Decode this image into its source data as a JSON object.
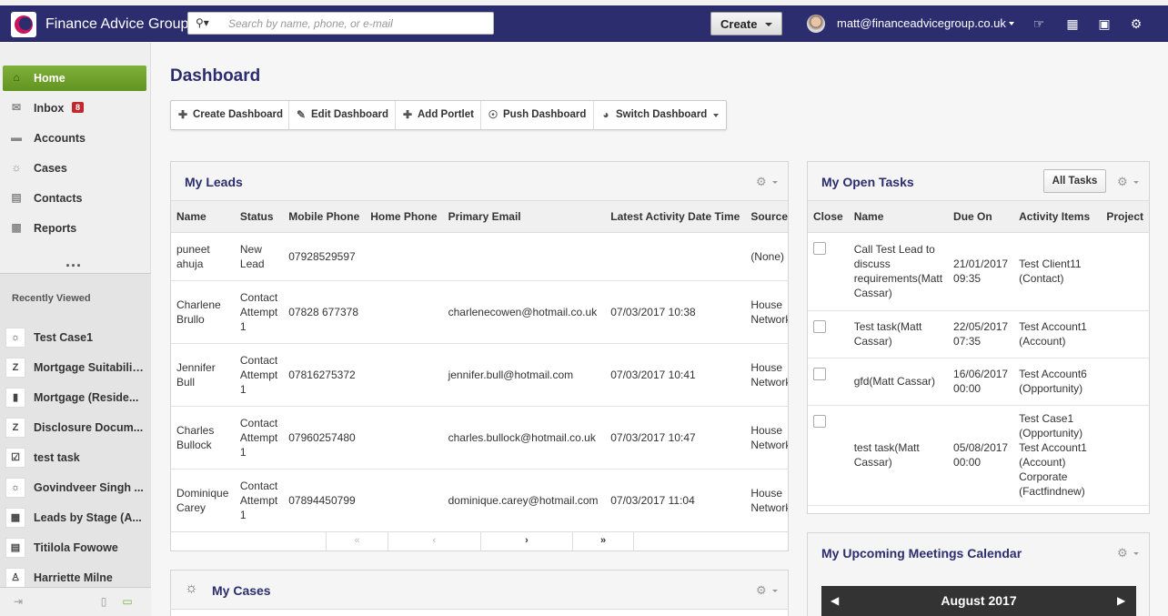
{
  "header": {
    "brand": "Finance Advice Group",
    "search_placeholder": "Search by name, phone, or e-mail",
    "create_label": "Create",
    "user_email": "matt@financeadvicegroup.co.uk"
  },
  "sidebar": {
    "items": [
      {
        "label": "Home",
        "icon": "home-icon"
      },
      {
        "label": "Inbox",
        "icon": "envelope-icon",
        "badge": "8"
      },
      {
        "label": "Accounts",
        "icon": "folder-icon"
      },
      {
        "label": "Cases",
        "icon": "lightbulb-icon"
      },
      {
        "label": "Contacts",
        "icon": "contact-card-icon"
      },
      {
        "label": "Reports",
        "icon": "bar-chart-icon"
      }
    ],
    "more": "...",
    "recently_viewed_title": "Recently Viewed",
    "recent": [
      {
        "label": "Test Case1",
        "icon": "lightbulb-icon"
      },
      {
        "label": "Mortgage Suitabilit...",
        "icon": "z-doc-icon"
      },
      {
        "label": "Mortgage (Reside...",
        "icon": "book-icon"
      },
      {
        "label": "Disclosure Docum...",
        "icon": "z-doc-icon"
      },
      {
        "label": "test task",
        "icon": "checkbox-icon"
      },
      {
        "label": "Govindveer Singh ...",
        "icon": "lightbulb-icon"
      },
      {
        "label": "Leads by Stage (A...",
        "icon": "bar-chart-icon"
      },
      {
        "label": "Titilola Fowowe",
        "icon": "contact-card-icon"
      },
      {
        "label": "Harriette Milne",
        "icon": "person-icon"
      }
    ]
  },
  "main": {
    "title": "Dashboard",
    "toolbar": [
      {
        "label": "Create Dashboard",
        "icon": "plus-icon"
      },
      {
        "label": "Edit Dashboard",
        "icon": "pencil-icon"
      },
      {
        "label": "Add Portlet",
        "icon": "plus-icon"
      },
      {
        "label": "Push Dashboard",
        "icon": "push-icon"
      },
      {
        "label": "Switch Dashboard",
        "icon": "switch-icon"
      }
    ]
  },
  "leads": {
    "title": "My Leads",
    "columns": [
      "Name",
      "Status",
      "Mobile Phone",
      "Home Phone",
      "Primary Email",
      "Latest Activity Date Time",
      "Source"
    ],
    "rows": [
      [
        "puneet ahuja",
        "New Lead",
        "07928529597",
        "",
        "",
        "",
        "(None)"
      ],
      [
        "Charlene Brullo",
        "Contact Attempt 1",
        "07828 677378",
        "",
        "charlenecowen@hotmail.co.uk",
        "07/03/2017 10:38",
        "House Network"
      ],
      [
        "Jennifer Bull",
        "Contact Attempt 1",
        "07816275372",
        "",
        "jennifer.bull@hotmail.com",
        "07/03/2017 10:41",
        "House Network"
      ],
      [
        "Charles Bullock",
        "Contact Attempt 1",
        "07960257480",
        "",
        "charles.bullock@hotmail.co.uk",
        "07/03/2017 10:47",
        "House Network"
      ],
      [
        "Dominique Carey",
        "Contact Attempt 1",
        "07894450799",
        "",
        "dominique.carey@hotmail.com",
        "07/03/2017 11:04",
        "House Network"
      ]
    ],
    "pager": [
      "«",
      "‹",
      "›",
      "»"
    ]
  },
  "tasks": {
    "title": "My Open Tasks",
    "all_tasks_label": "All Tasks",
    "columns": [
      "Close",
      "Name",
      "Due On",
      "Activity Items",
      "Project"
    ],
    "rows": [
      [
        "",
        "Call Test Lead to discuss requirements(Matt Cassar)",
        "21/01/2017 09:35",
        "Test Client11 (Contact)",
        ""
      ],
      [
        "",
        "Test task(Matt Cassar)",
        "22/05/2017 07:35",
        "Test Account1 (Account)",
        ""
      ],
      [
        "",
        "gfd(Matt Cassar)",
        "16/06/2017 00:00",
        "Test Account6 (Opportunity)",
        ""
      ],
      [
        "",
        "test task(Matt Cassar)",
        "05/08/2017 00:00",
        "Test Case1 (Opportunity) Test Account1 (Account) Corporate (Factfindnew)",
        ""
      ]
    ]
  },
  "cases": {
    "title": "My Cases"
  },
  "meetings": {
    "title": "My Upcoming Meetings Calendar",
    "month": "August 2017"
  }
}
